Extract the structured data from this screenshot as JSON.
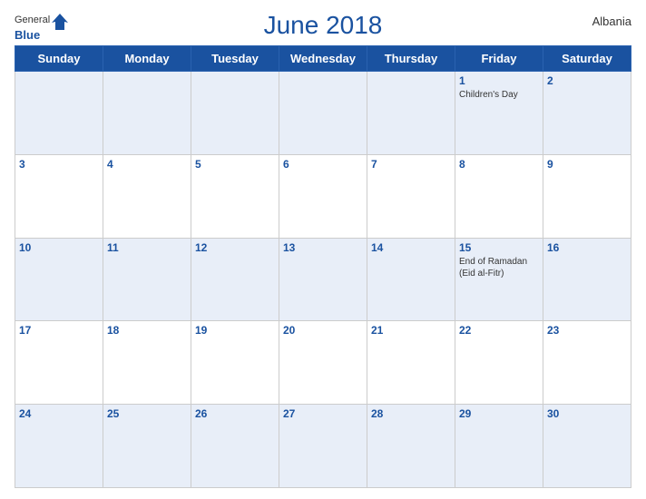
{
  "header": {
    "logo_general": "General",
    "logo_blue": "Blue",
    "title": "June 2018",
    "country": "Albania"
  },
  "weekdays": [
    "Sunday",
    "Monday",
    "Tuesday",
    "Wednesday",
    "Thursday",
    "Friday",
    "Saturday"
  ],
  "weeks": [
    [
      {
        "day": "",
        "holiday": ""
      },
      {
        "day": "",
        "holiday": ""
      },
      {
        "day": "",
        "holiday": ""
      },
      {
        "day": "",
        "holiday": ""
      },
      {
        "day": "",
        "holiday": ""
      },
      {
        "day": "1",
        "holiday": "Children's Day"
      },
      {
        "day": "2",
        "holiday": ""
      }
    ],
    [
      {
        "day": "3",
        "holiday": ""
      },
      {
        "day": "4",
        "holiday": ""
      },
      {
        "day": "5",
        "holiday": ""
      },
      {
        "day": "6",
        "holiday": ""
      },
      {
        "day": "7",
        "holiday": ""
      },
      {
        "day": "8",
        "holiday": ""
      },
      {
        "day": "9",
        "holiday": ""
      }
    ],
    [
      {
        "day": "10",
        "holiday": ""
      },
      {
        "day": "11",
        "holiday": ""
      },
      {
        "day": "12",
        "holiday": ""
      },
      {
        "day": "13",
        "holiday": ""
      },
      {
        "day": "14",
        "holiday": ""
      },
      {
        "day": "15",
        "holiday": "End of Ramadan (Eid al-Fitr)"
      },
      {
        "day": "16",
        "holiday": ""
      }
    ],
    [
      {
        "day": "17",
        "holiday": ""
      },
      {
        "day": "18",
        "holiday": ""
      },
      {
        "day": "19",
        "holiday": ""
      },
      {
        "day": "20",
        "holiday": ""
      },
      {
        "day": "21",
        "holiday": ""
      },
      {
        "day": "22",
        "holiday": ""
      },
      {
        "day": "23",
        "holiday": ""
      }
    ],
    [
      {
        "day": "24",
        "holiday": ""
      },
      {
        "day": "25",
        "holiday": ""
      },
      {
        "day": "26",
        "holiday": ""
      },
      {
        "day": "27",
        "holiday": ""
      },
      {
        "day": "28",
        "holiday": ""
      },
      {
        "day": "29",
        "holiday": ""
      },
      {
        "day": "30",
        "holiday": ""
      }
    ]
  ]
}
